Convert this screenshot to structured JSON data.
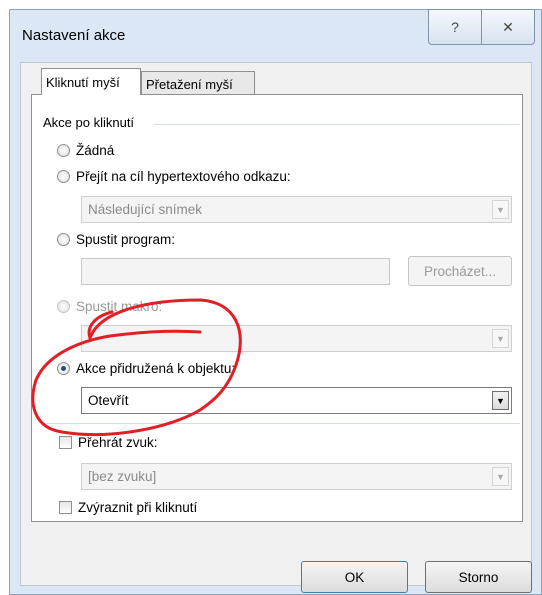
{
  "window": {
    "title": "Nastavení akce",
    "help": "?",
    "close": "✕"
  },
  "tabs": [
    {
      "label": "Kliknutí myší"
    },
    {
      "label": "Přetažení myší"
    }
  ],
  "group": {
    "label": "Akce po kliknutí"
  },
  "options": {
    "none": "Žádná",
    "hyperlink": "Přejít na cíl hypertextového odkazu:",
    "hyperlink_value": "Následující snímek",
    "run_program": "Spustit program:",
    "browse": "Procházet...",
    "run_macro": "Spustit makro:",
    "object_action": "Akce přidružená k objektu:",
    "object_value": "Otevřít",
    "play_sound": "Přehrát zvuk:",
    "sound_value": "[bez zvuku]",
    "highlight": "Zvýraznit při kliknutí"
  },
  "buttons": {
    "ok": "OK",
    "cancel": "Storno"
  },
  "colors": {
    "annotation": "#e01f26",
    "titlebar": "#dbe7f4",
    "selected_radio": "#1c5180"
  },
  "icons": {
    "dropdown": "▼"
  }
}
